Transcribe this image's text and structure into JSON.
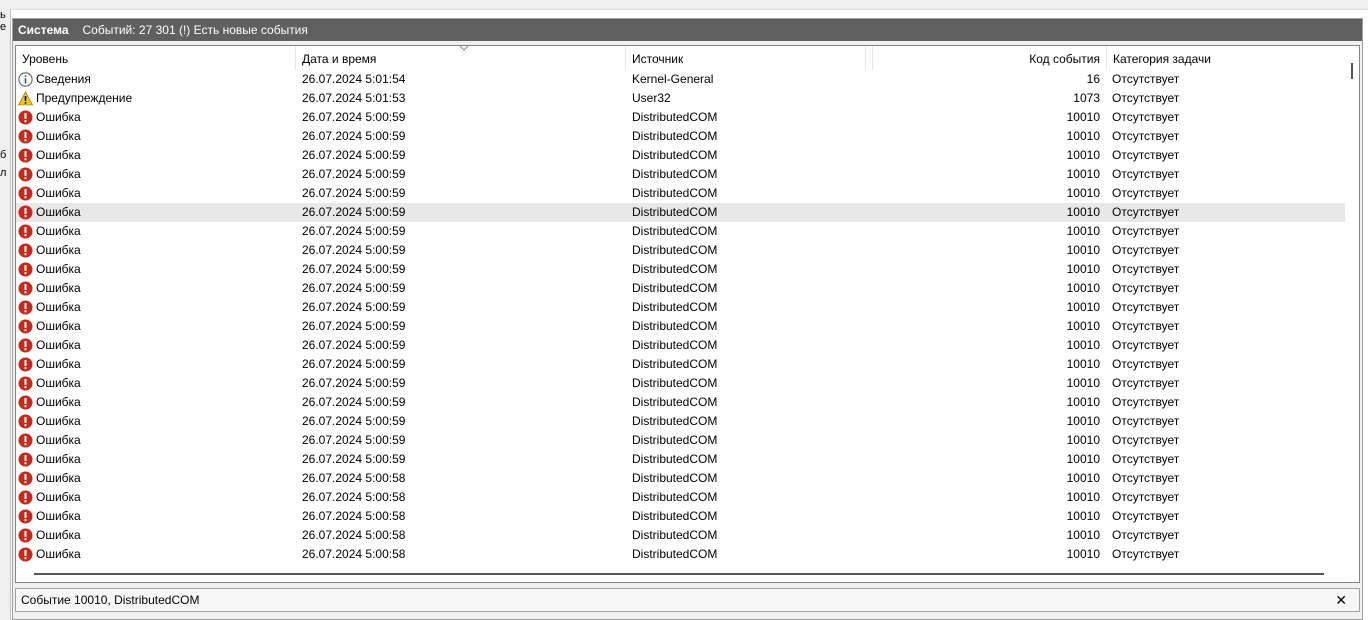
{
  "left_strip": [
    "ь",
    "е",
    "б",
    "л"
  ],
  "header": {
    "title": "Система",
    "count_text": "Событий: 27 301 (!) Есть новые события"
  },
  "columns": [
    {
      "key": "level",
      "label": "Уровень"
    },
    {
      "key": "datetime",
      "label": "Дата и время"
    },
    {
      "key": "source",
      "label": "Источник"
    },
    {
      "key": "empty",
      "label": ""
    },
    {
      "key": "event_id",
      "label": "Код события"
    },
    {
      "key": "task_category",
      "label": "Категория задачи"
    }
  ],
  "rows": [
    {
      "level_icon": "info-icon",
      "level": "Сведения",
      "datetime": "26.07.2024 5:01:54",
      "source": "Kernel-General",
      "event_id": "16",
      "task_category": "Отсутствует"
    },
    {
      "level_icon": "warning-icon",
      "level": "Предупреждение",
      "datetime": "26.07.2024 5:01:53",
      "source": "User32",
      "event_id": "1073",
      "task_category": "Отсутствует"
    },
    {
      "level_icon": "error-icon",
      "level": "Ошибка",
      "datetime": "26.07.2024 5:00:59",
      "source": "DistributedCOM",
      "event_id": "10010",
      "task_category": "Отсутствует"
    },
    {
      "level_icon": "error-icon",
      "level": "Ошибка",
      "datetime": "26.07.2024 5:00:59",
      "source": "DistributedCOM",
      "event_id": "10010",
      "task_category": "Отсутствует"
    },
    {
      "level_icon": "error-icon",
      "level": "Ошибка",
      "datetime": "26.07.2024 5:00:59",
      "source": "DistributedCOM",
      "event_id": "10010",
      "task_category": "Отсутствует"
    },
    {
      "level_icon": "error-icon",
      "level": "Ошибка",
      "datetime": "26.07.2024 5:00:59",
      "source": "DistributedCOM",
      "event_id": "10010",
      "task_category": "Отсутствует"
    },
    {
      "level_icon": "error-icon",
      "level": "Ошибка",
      "datetime": "26.07.2024 5:00:59",
      "source": "DistributedCOM",
      "event_id": "10010",
      "task_category": "Отсутствует"
    },
    {
      "level_icon": "error-icon",
      "level": "Ошибка",
      "datetime": "26.07.2024 5:00:59",
      "source": "DistributedCOM",
      "event_id": "10010",
      "task_category": "Отсутствует",
      "selected": true
    },
    {
      "level_icon": "error-icon",
      "level": "Ошибка",
      "datetime": "26.07.2024 5:00:59",
      "source": "DistributedCOM",
      "event_id": "10010",
      "task_category": "Отсутствует"
    },
    {
      "level_icon": "error-icon",
      "level": "Ошибка",
      "datetime": "26.07.2024 5:00:59",
      "source": "DistributedCOM",
      "event_id": "10010",
      "task_category": "Отсутствует"
    },
    {
      "level_icon": "error-icon",
      "level": "Ошибка",
      "datetime": "26.07.2024 5:00:59",
      "source": "DistributedCOM",
      "event_id": "10010",
      "task_category": "Отсутствует"
    },
    {
      "level_icon": "error-icon",
      "level": "Ошибка",
      "datetime": "26.07.2024 5:00:59",
      "source": "DistributedCOM",
      "event_id": "10010",
      "task_category": "Отсутствует"
    },
    {
      "level_icon": "error-icon",
      "level": "Ошибка",
      "datetime": "26.07.2024 5:00:59",
      "source": "DistributedCOM",
      "event_id": "10010",
      "task_category": "Отсутствует"
    },
    {
      "level_icon": "error-icon",
      "level": "Ошибка",
      "datetime": "26.07.2024 5:00:59",
      "source": "DistributedCOM",
      "event_id": "10010",
      "task_category": "Отсутствует"
    },
    {
      "level_icon": "error-icon",
      "level": "Ошибка",
      "datetime": "26.07.2024 5:00:59",
      "source": "DistributedCOM",
      "event_id": "10010",
      "task_category": "Отсутствует"
    },
    {
      "level_icon": "error-icon",
      "level": "Ошибка",
      "datetime": "26.07.2024 5:00:59",
      "source": "DistributedCOM",
      "event_id": "10010",
      "task_category": "Отсутствует"
    },
    {
      "level_icon": "error-icon",
      "level": "Ошибка",
      "datetime": "26.07.2024 5:00:59",
      "source": "DistributedCOM",
      "event_id": "10010",
      "task_category": "Отсутствует"
    },
    {
      "level_icon": "error-icon",
      "level": "Ошибка",
      "datetime": "26.07.2024 5:00:59",
      "source": "DistributedCOM",
      "event_id": "10010",
      "task_category": "Отсутствует"
    },
    {
      "level_icon": "error-icon",
      "level": "Ошибка",
      "datetime": "26.07.2024 5:00:59",
      "source": "DistributedCOM",
      "event_id": "10010",
      "task_category": "Отсутствует"
    },
    {
      "level_icon": "error-icon",
      "level": "Ошибка",
      "datetime": "26.07.2024 5:00:59",
      "source": "DistributedCOM",
      "event_id": "10010",
      "task_category": "Отсутствует"
    },
    {
      "level_icon": "error-icon",
      "level": "Ошибка",
      "datetime": "26.07.2024 5:00:59",
      "source": "DistributedCOM",
      "event_id": "10010",
      "task_category": "Отсутствует"
    },
    {
      "level_icon": "error-icon",
      "level": "Ошибка",
      "datetime": "26.07.2024 5:00:58",
      "source": "DistributedCOM",
      "event_id": "10010",
      "task_category": "Отсутствует"
    },
    {
      "level_icon": "error-icon",
      "level": "Ошибка",
      "datetime": "26.07.2024 5:00:58",
      "source": "DistributedCOM",
      "event_id": "10010",
      "task_category": "Отсутствует"
    },
    {
      "level_icon": "error-icon",
      "level": "Ошибка",
      "datetime": "26.07.2024 5:00:58",
      "source": "DistributedCOM",
      "event_id": "10010",
      "task_category": "Отсутствует"
    },
    {
      "level_icon": "error-icon",
      "level": "Ошибка",
      "datetime": "26.07.2024 5:00:58",
      "source": "DistributedCOM",
      "event_id": "10010",
      "task_category": "Отсутствует"
    },
    {
      "level_icon": "error-icon",
      "level": "Ошибка",
      "datetime": "26.07.2024 5:00:58",
      "source": "DistributedCOM",
      "event_id": "10010",
      "task_category": "Отсутствует"
    }
  ],
  "detail": {
    "title": "Событие 10010, DistributedCOM",
    "close_glyph": "✕"
  },
  "colors": {
    "header_bg": "#606060",
    "selected_row": "#e8e8e8",
    "error": "#c42b1c",
    "warning": "#f2c811",
    "info_ring": "#6d6d6d"
  }
}
